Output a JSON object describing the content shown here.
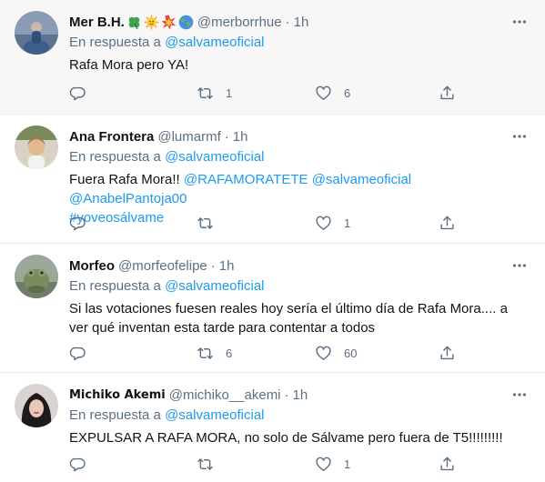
{
  "common": {
    "reply_prefix": "En respuesta a",
    "reply_handle": "@salvameoficial",
    "separator": "·"
  },
  "colors": {
    "link": "#1d9bf0",
    "secondary_text": "#5b7083",
    "highlight_bg": "#f7f7f7",
    "divider": "#e6ecf0"
  },
  "tweets": [
    {
      "name": "Mer B.H.",
      "name_emojis": [
        "four-leaf-clover-icon",
        "sun-face-icon",
        "collision-icon",
        "globe-icon"
      ],
      "handle": "@merborrhue",
      "time": "1h",
      "text": "Rafa Mora pero YA!",
      "replies": "",
      "retweets": "1",
      "likes": "6"
    },
    {
      "name": "Ana Frontera",
      "handle": "@lumarmf",
      "time": "1h",
      "text_prefix": "Fuera Rafa Mora!! ",
      "text_links": [
        "@RAFAMORATETE",
        "@salvameoficial",
        "@AnabelPantoja00",
        "#yoveosálvame"
      ],
      "replies": "",
      "retweets": "",
      "likes": "1"
    },
    {
      "name": "Morfeo",
      "handle": "@morfeofelipe",
      "time": "1h",
      "text": "Si las votaciones fuesen reales hoy sería el último día de Rafa Mora.... a ver qué inventan esta tarde para contentar a todos",
      "replies": "",
      "retweets": "6",
      "likes": "60"
    },
    {
      "name": "Michiko Akemi",
      "handle": "@michiko__akemi",
      "time": "1h",
      "text": "EXPULSAR A RAFA MORA, no solo de Sálvame pero fuera de T5!!!!!!!!!",
      "replies": "",
      "retweets": "",
      "likes": "1"
    }
  ]
}
